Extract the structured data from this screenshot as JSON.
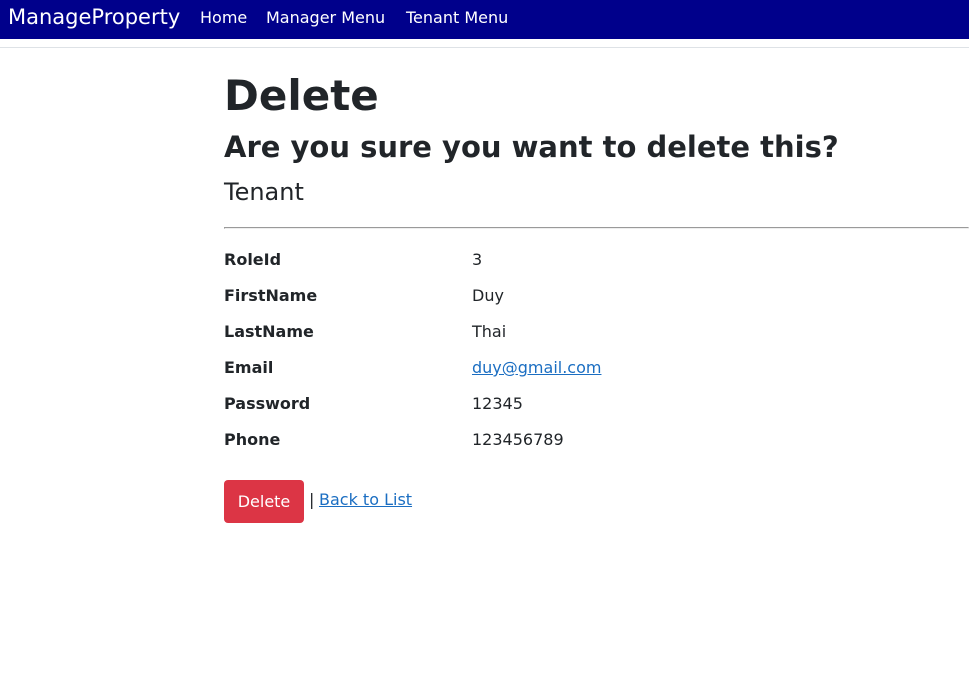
{
  "navbar": {
    "brand": "ManageProperty",
    "links": [
      "Home",
      "Manager Menu",
      "Tenant Menu"
    ]
  },
  "page": {
    "title": "Delete",
    "confirm": "Are you sure you want to delete this?",
    "entity": "Tenant"
  },
  "fields": [
    {
      "label": "RoleId",
      "value": "3"
    },
    {
      "label": "FirstName",
      "value": "Duy"
    },
    {
      "label": "LastName",
      "value": "Thai"
    },
    {
      "label": "Email",
      "value": "duy@gmail.com"
    },
    {
      "label": "Password",
      "value": "12345"
    },
    {
      "label": "Phone",
      "value": "123456789"
    }
  ],
  "actions": {
    "delete_label": "Delete",
    "separator": "|",
    "back_label": "Back to List"
  },
  "colors": {
    "navbar": "#00008b",
    "danger": "#dc3545",
    "link": "#1b6ec2"
  }
}
